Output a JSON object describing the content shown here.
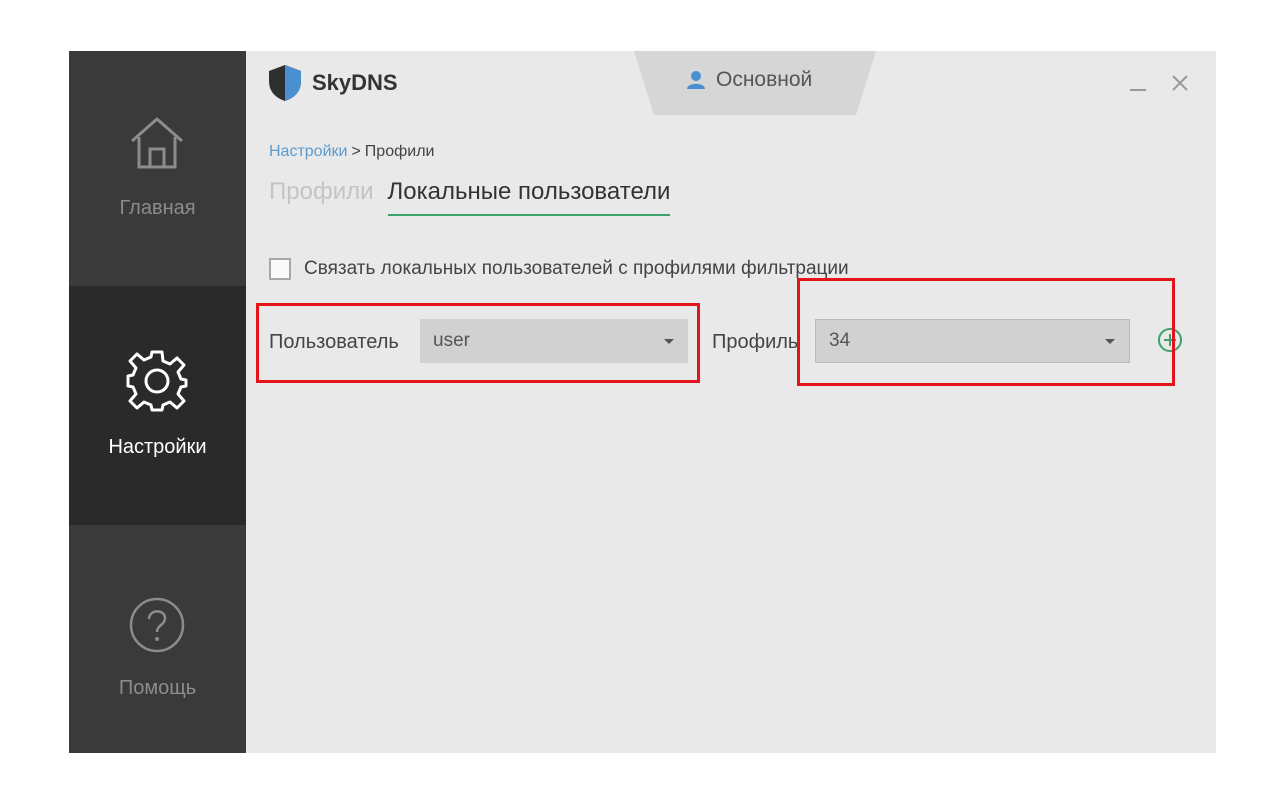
{
  "app": {
    "name": "SkyDNS"
  },
  "sidebar": {
    "items": [
      {
        "label": "Главная",
        "icon": "home-icon"
      },
      {
        "label": "Настройки",
        "icon": "gear-icon",
        "active": true
      },
      {
        "label": "Помощь",
        "icon": "help-icon"
      }
    ]
  },
  "header": {
    "profile_label": "Основной"
  },
  "breadcrumb": {
    "link": "Настройки",
    "separator": ">",
    "current": "Профили"
  },
  "tabs": [
    {
      "label": "Профили",
      "active": false
    },
    {
      "label": "Локальные пользователи",
      "active": true
    }
  ],
  "form": {
    "link_checkbox_label": "Связать локальных пользователей с профилями фильтрации",
    "link_checkbox_checked": false,
    "user_label": "Пользователь",
    "user_value": "user",
    "profile_label": "Профиль",
    "profile_value": "34"
  },
  "colors": {
    "sidebar_bg": "#3a3a3a",
    "sidebar_active_bg": "#2a2a2a",
    "accent_green": "#39a36b",
    "link_blue": "#5b9bd0",
    "highlight_red": "#e3141b"
  }
}
